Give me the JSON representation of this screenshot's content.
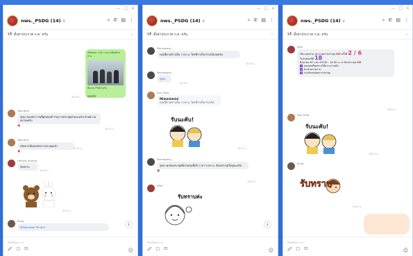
{
  "window_controls": [
    "—",
    "☐",
    "✕"
  ],
  "group": {
    "name": "nws._PSDG (14)",
    "caret": "∨"
  },
  "pinned": "ตั้งค่าประกาศ ก.ค. ครับ",
  "composer": {
    "placeholder": "พิมพ์ข้อความ"
  },
  "w1": {
    "green_caption": "เช็คอินคา 100 รายการที่ผลิตในบ้าน",
    "green_photo_caption": "ทีมงาน PSDG ครับ",
    "green_text": "ทุกครับ",
    "green_time": "08:16 น.",
    "m1_sender": "Taoruthai",
    "m1_text": "@All ขอแจ้งว่าวันนี้ทุกคนเข้าร่วมการประชุมด้วยนะครับ ด้วยความเคารพครับ",
    "m1_time": "09:14 น.",
    "m2_sender": "Taoruthai",
    "m2_text": "หลังจากนั้นยกเลิกการประชุมแล้ว",
    "m2_time": "09:15 น.",
    "m3_sender": "Leelajai_Kluong",
    "m3_text": "รับทราบ",
    "m3_time": "09:16 น.",
    "m4_sender": "Bung",
    "m4_text": "@Taoruthai รับ เม.ย.",
    "sticker_time": "10:01 น."
  },
  "w2": {
    "m1_sender": "Manaspong",
    "m1_text": "พรุ่งนี้ทานข้าวเย็น 7:00 น. ใครที่ว่างก็มาร่วมได้เลยครับ",
    "m1_time": "18:15 น.",
    "m2_sender": "Manaspong",
    "m2_text": "@All",
    "m2_time": "18:16 น.",
    "m3_sender": "Nuu_Ning",
    "m3_reply_name": "Mimmiemini",
    "m3_reply_text": "พรุ่งนี้ทานข้าวเย็น 7:00 น. ใครที่ว่างก็มาร่วมได้",
    "sticker1_text": "รับนะคับ!",
    "sticker1_time": "18:51 น.",
    "m4_sender": "Manaspong",
    "m4_text": "@All ทุกคนประชุมทีมวันพรุ่งนี้เช้า เวลา 9:00 น. ห้องประชุมใหญ่นะครับ",
    "m4_time": "19:03 น.",
    "m5_sender": "Milla",
    "sticker2_text": "รับทราบค่ะ"
  },
  "w3": {
    "m1_sender": "Milla",
    "m1_line1": "เรียน ทุกท่าน ประกาศการประชุม",
    "m1_kv": "KM",
    "m1_round": "ครั้งที่",
    "m1_big": "2 / 6",
    "m1_line2": "ในวันจันทร์ที่",
    "m1_day": "18",
    "m1_line3": "มิถุนายน 67 เวลา 09:30 - 14:30 น. ณ ห้องประชุม",
    "m1_kv2": "KM",
    "item1": "ขอบคุณที่ทุกท่านให้ความร่วมมือ",
    "item2": "นำเสนอรายงาน",
    "item3": "ร่วมกันสรุปผลการประชุม",
    "m1_time": "08:21 น.",
    "m2_sender": "Nuu_Ning",
    "sticker1_text": "รับนะคับ!",
    "sticker1_time": "08:45 น.",
    "m3_sender": "Bung",
    "sticker2_text": "รับทราบ",
    "sticker2_time": "09:02 น."
  }
}
